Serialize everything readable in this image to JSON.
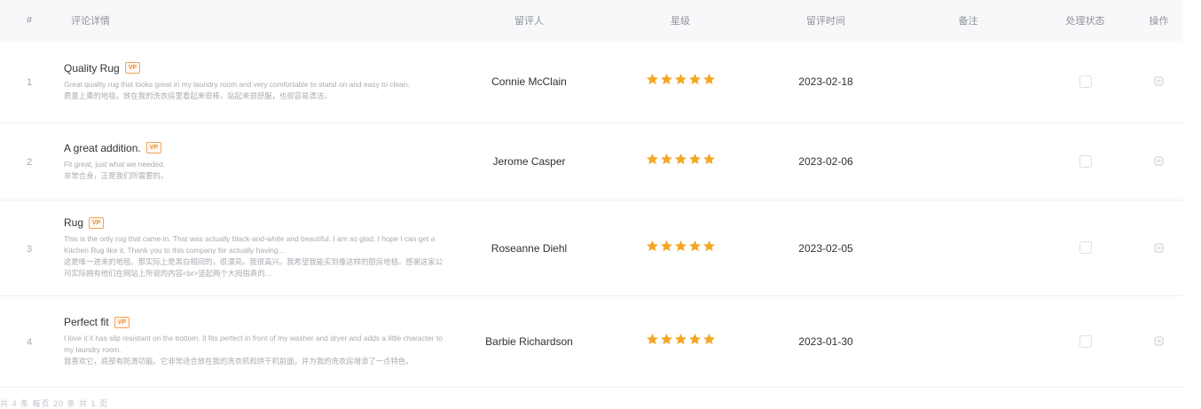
{
  "header": {
    "index": "#",
    "detail": "评论详情",
    "reviewer": "留评人",
    "rating": "星级",
    "time": "留评时间",
    "note": "备注",
    "status": "处理状态",
    "action": "操作"
  },
  "colors": {
    "star": "#f5a623",
    "badge": "#ef8a2c",
    "muted": "#a8abb2"
  },
  "rows": [
    {
      "index": "1",
      "title": "Quality Rug",
      "badge": "VP",
      "text_en": "Great quality rug that looks great in my laundry room and very comfortable to stand on and easy to clean.",
      "text_zh": "质量上乘的地毯，放在我的洗衣房里看起来很棒，站起来很舒服，也很容易清洁。",
      "reviewer": "Connie McClain",
      "stars": 5,
      "date": "2023-02-18",
      "note": ""
    },
    {
      "index": "2",
      "title": "A great addition.",
      "badge": "VP",
      "text_en": "Fit great, just what we needed.",
      "text_zh": "非常合身，正是我们所需要的。",
      "reviewer": "Jerome Casper",
      "stars": 5,
      "date": "2023-02-06",
      "note": ""
    },
    {
      "index": "3",
      "title": "Rug",
      "badge": "VP",
      "text_en": "This is the only rug that came in. That was actually black-and-white and beautiful. I am so glad. I hope I can get a Kitchen Rug like it. Thank you to this company for actually having...",
      "text_zh": "这是唯一进来的地毯。那实际上是黑白相间的，很漂亮。我很高兴。我希望我能买到像这样的厨房地毯。感谢这家公司实际拥有他们在网站上所说的内容<br>竖起两个大拇指真的...",
      "reviewer": "Roseanne Diehl",
      "stars": 5,
      "date": "2023-02-05",
      "note": ""
    },
    {
      "index": "4",
      "title": "Perfect fit",
      "badge": "VP",
      "text_en": "I love it it has slip resistant on the bottom. It fits perfect in front of my washer and dryer and adds a little character to my laundry room.",
      "text_zh": "我喜欢它，底部有防滑功能。它非常适合放在我的洗衣机和烘干机前面，并为我的洗衣房增添了一点特色。",
      "reviewer": "Barbie Richardson",
      "stars": 5,
      "date": "2023-01-30",
      "note": ""
    }
  ],
  "footer": "共 4 条 每页 20 条 共 1 页"
}
